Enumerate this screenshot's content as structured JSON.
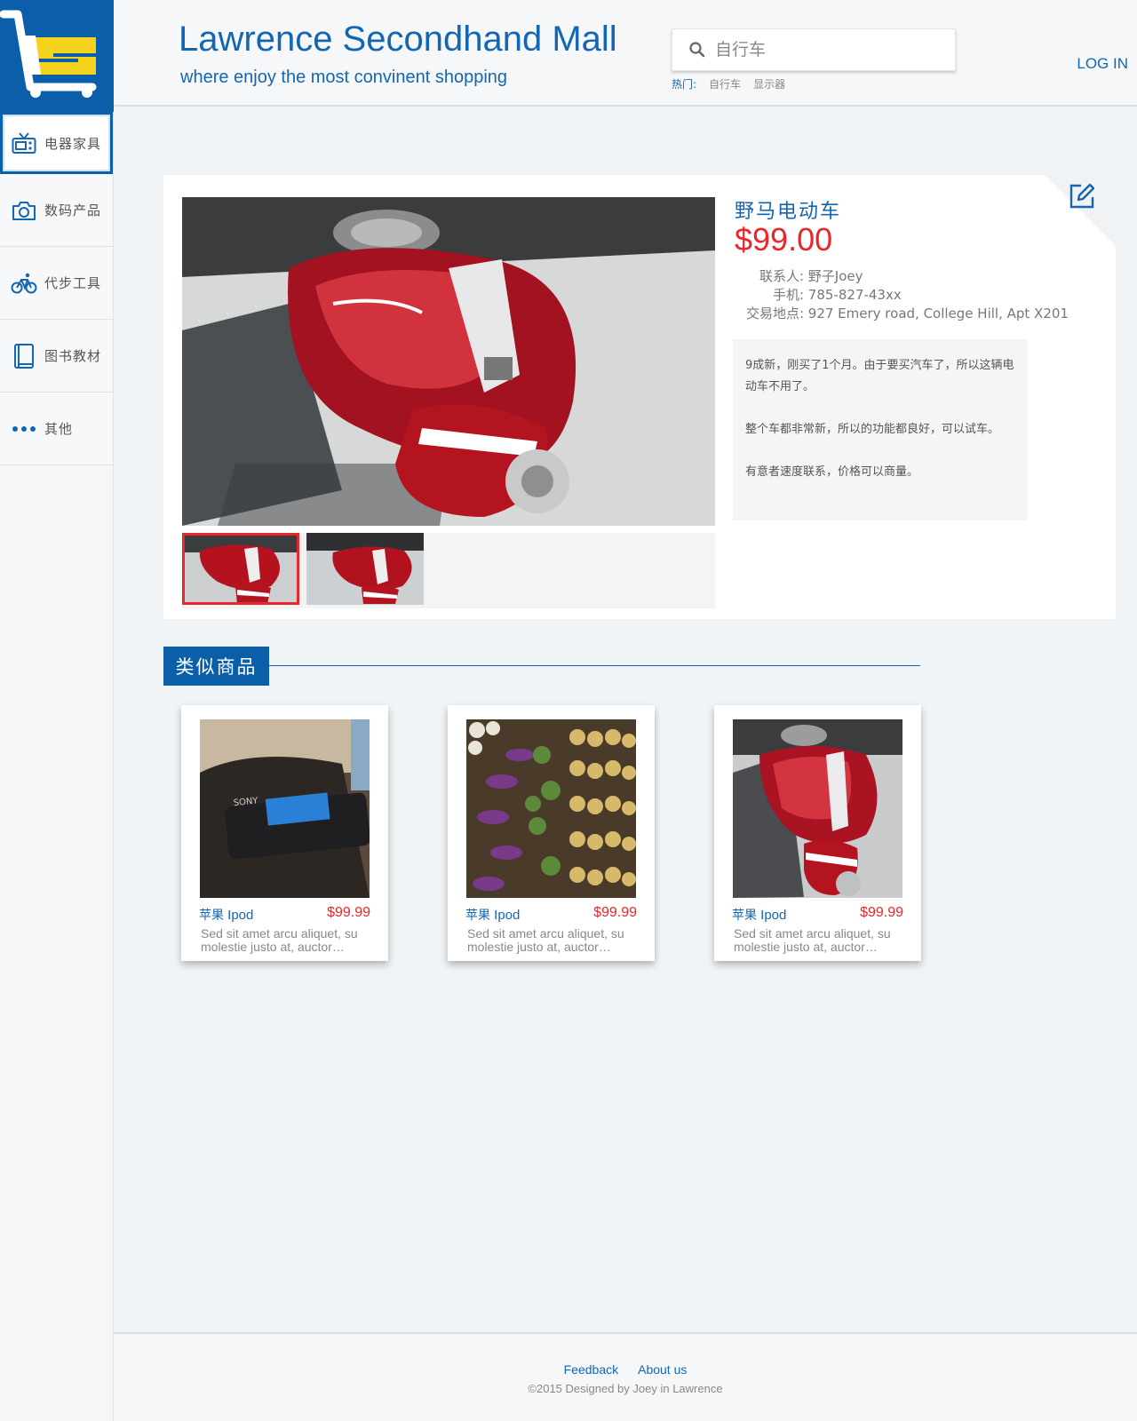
{
  "brand": {
    "title": "Lawrence Secondhand Mall",
    "subtitle": "where enjoy the most convinent shopping"
  },
  "colors": {
    "primary": "#1366b2",
    "logo_bg": "#0b5fa8",
    "logo_accent": "#f5d21d",
    "price": "#e8262b"
  },
  "search": {
    "placeholder": "自行车",
    "hot_label": "热门:",
    "hot_tags": [
      "自行车",
      "显示器"
    ]
  },
  "header": {
    "login_label": "LOG IN"
  },
  "sidebar": {
    "items": [
      {
        "label": "电器家具",
        "icon": "tv-icon",
        "active": true
      },
      {
        "label": "数码产品",
        "icon": "camera-icon",
        "active": false
      },
      {
        "label": "代步工具",
        "icon": "bicycle-icon",
        "active": false
      },
      {
        "label": "图书教材",
        "icon": "book-icon",
        "active": false
      },
      {
        "label": "其他",
        "icon": "more-dots-icon",
        "active": false
      }
    ]
  },
  "product": {
    "title": "野马电动车",
    "price": "$99.00",
    "contact_label": "联系人:",
    "contact_value": "野子Joey",
    "phone_label": "手机:",
    "phone_value": "785-827-43xx",
    "location_label": "交易地点:",
    "location_value": "927 Emery road, College Hill, Apt X201",
    "description": [
      "9成新，刚买了1个月。由于要买汽车了，所以这辆电动车不用了。",
      "整个车都非常新，所以的功能都良好，可以试车。",
      "有意者速度联系，价格可以商量。"
    ],
    "thumbnail_count": 2,
    "selected_thumbnail": 1
  },
  "similar": {
    "title": "类似商品",
    "items": [
      {
        "name_cn": "苹果",
        "name_en": "Ipod",
        "price": "$99.99",
        "desc": "Sed sit amet arcu aliquet, su molestie justo at, auctor…",
        "image": "sony-mp3-player"
      },
      {
        "name_cn": "苹果",
        "name_en": "Ipod",
        "price": "$99.99",
        "desc": "Sed sit amet arcu aliquet, su molestie justo at, auctor…",
        "image": "vegetable-market"
      },
      {
        "name_cn": "苹果",
        "name_en": "Ipod",
        "price": "$99.99",
        "desc": "Sed sit amet arcu aliquet, su molestie justo at, auctor…",
        "image": "red-vespa-scooter"
      }
    ]
  },
  "footer": {
    "feedback": "Feedback",
    "about": "About us",
    "copyright": "©2015  Designed by Joey in Lawrence"
  }
}
